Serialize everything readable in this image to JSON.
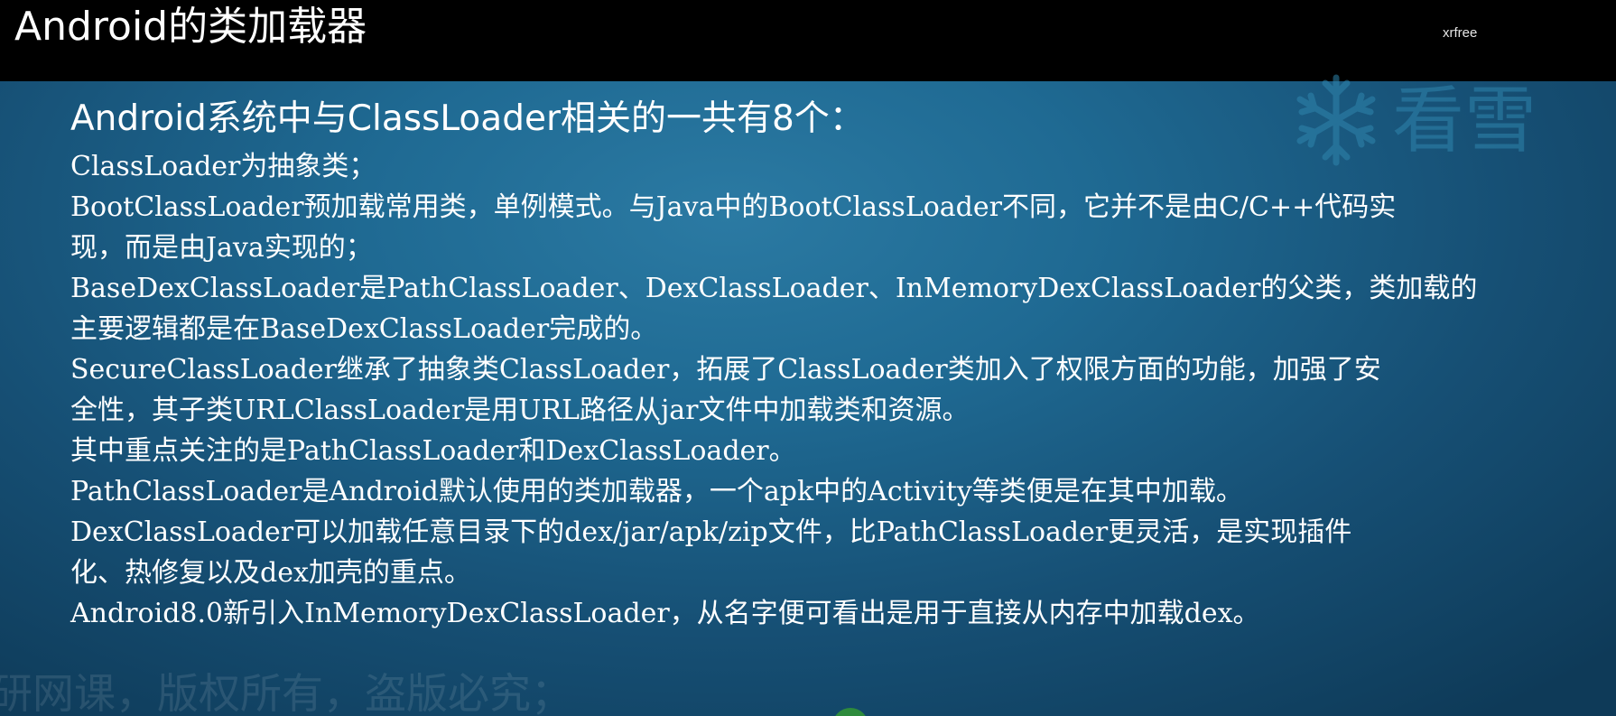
{
  "header": {
    "title": "Android的类加载器",
    "author": "xrfree"
  },
  "watermark": {
    "brand_text": "看雪",
    "icon": "snowflake-icon",
    "bottom_text": "研网课，版权所有，盗版必究；"
  },
  "main": {
    "heading": "Android系统中与ClassLoader相关的一共有8个：",
    "lines": [
      "ClassLoader为抽象类；",
      "BootClassLoader预加载常用类，单例模式。与Java中的BootClassLoader不同，它并不是由C/C++代码实",
      "现，而是由Java实现的；",
      "BaseDexClassLoader是PathClassLoader、DexClassLoader、InMemoryDexClassLoader的父类，类加载的",
      "主要逻辑都是在BaseDexClassLoader完成的。",
      "SecureClassLoader继承了抽象类ClassLoader，拓展了ClassLoader类加入了权限方面的功能，加强了安",
      "全性，其子类URLClassLoader是用URL路径从jar文件中加载类和资源。",
      "其中重点关注的是PathClassLoader和DexClassLoader。",
      "PathClassLoader是Android默认使用的类加载器，一个apk中的Activity等类便是在其中加载。",
      "DexClassLoader可以加载任意目录下的dex/jar/apk/zip文件，比PathClassLoader更灵活，是实现插件",
      "化、热修复以及dex加壳的重点。",
      "Android8.0新引入InMemoryDexClassLoader，从名字便可看出是用于直接从内存中加载dex。"
    ]
  },
  "colors": {
    "title_bar": "#000000",
    "background": "#1f6a93",
    "text": "#ffffff"
  }
}
